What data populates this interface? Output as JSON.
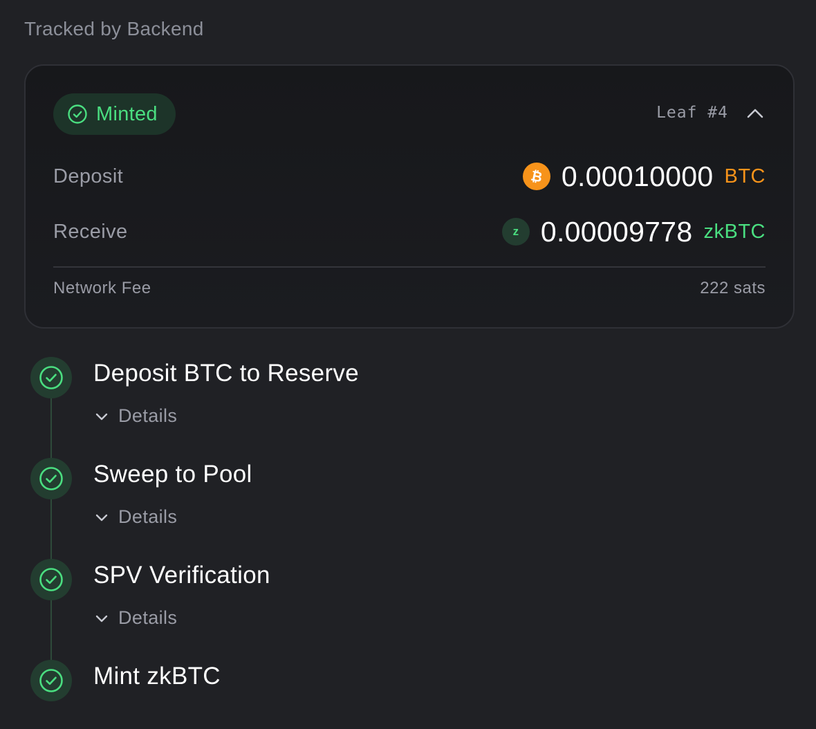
{
  "section_title": "Tracked by Backend",
  "card": {
    "status_badge": "Minted",
    "leaf_label": "Leaf #4",
    "deposit": {
      "label": "Deposit",
      "coin_icon": "bitcoin-icon",
      "amount": "0.00010000",
      "unit": "BTC"
    },
    "receive": {
      "label": "Receive",
      "coin_icon": "zkbtc-icon",
      "coin_letter": "z",
      "amount": "0.00009778",
      "unit": "zkBTC"
    },
    "fee": {
      "label": "Network Fee",
      "value": "222 sats"
    }
  },
  "steps": [
    {
      "title": "Deposit BTC to Reserve",
      "details_label": "Details",
      "status": "complete"
    },
    {
      "title": "Sweep to Pool",
      "details_label": "Details",
      "status": "complete"
    },
    {
      "title": "SPV Verification",
      "details_label": "Details",
      "status": "complete"
    },
    {
      "title": "Mint zkBTC",
      "status": "complete"
    }
  ],
  "colors": {
    "background": "#202125",
    "success": "#4ade80",
    "bitcoin": "#f7931a",
    "muted_text": "#9a9ca6"
  }
}
